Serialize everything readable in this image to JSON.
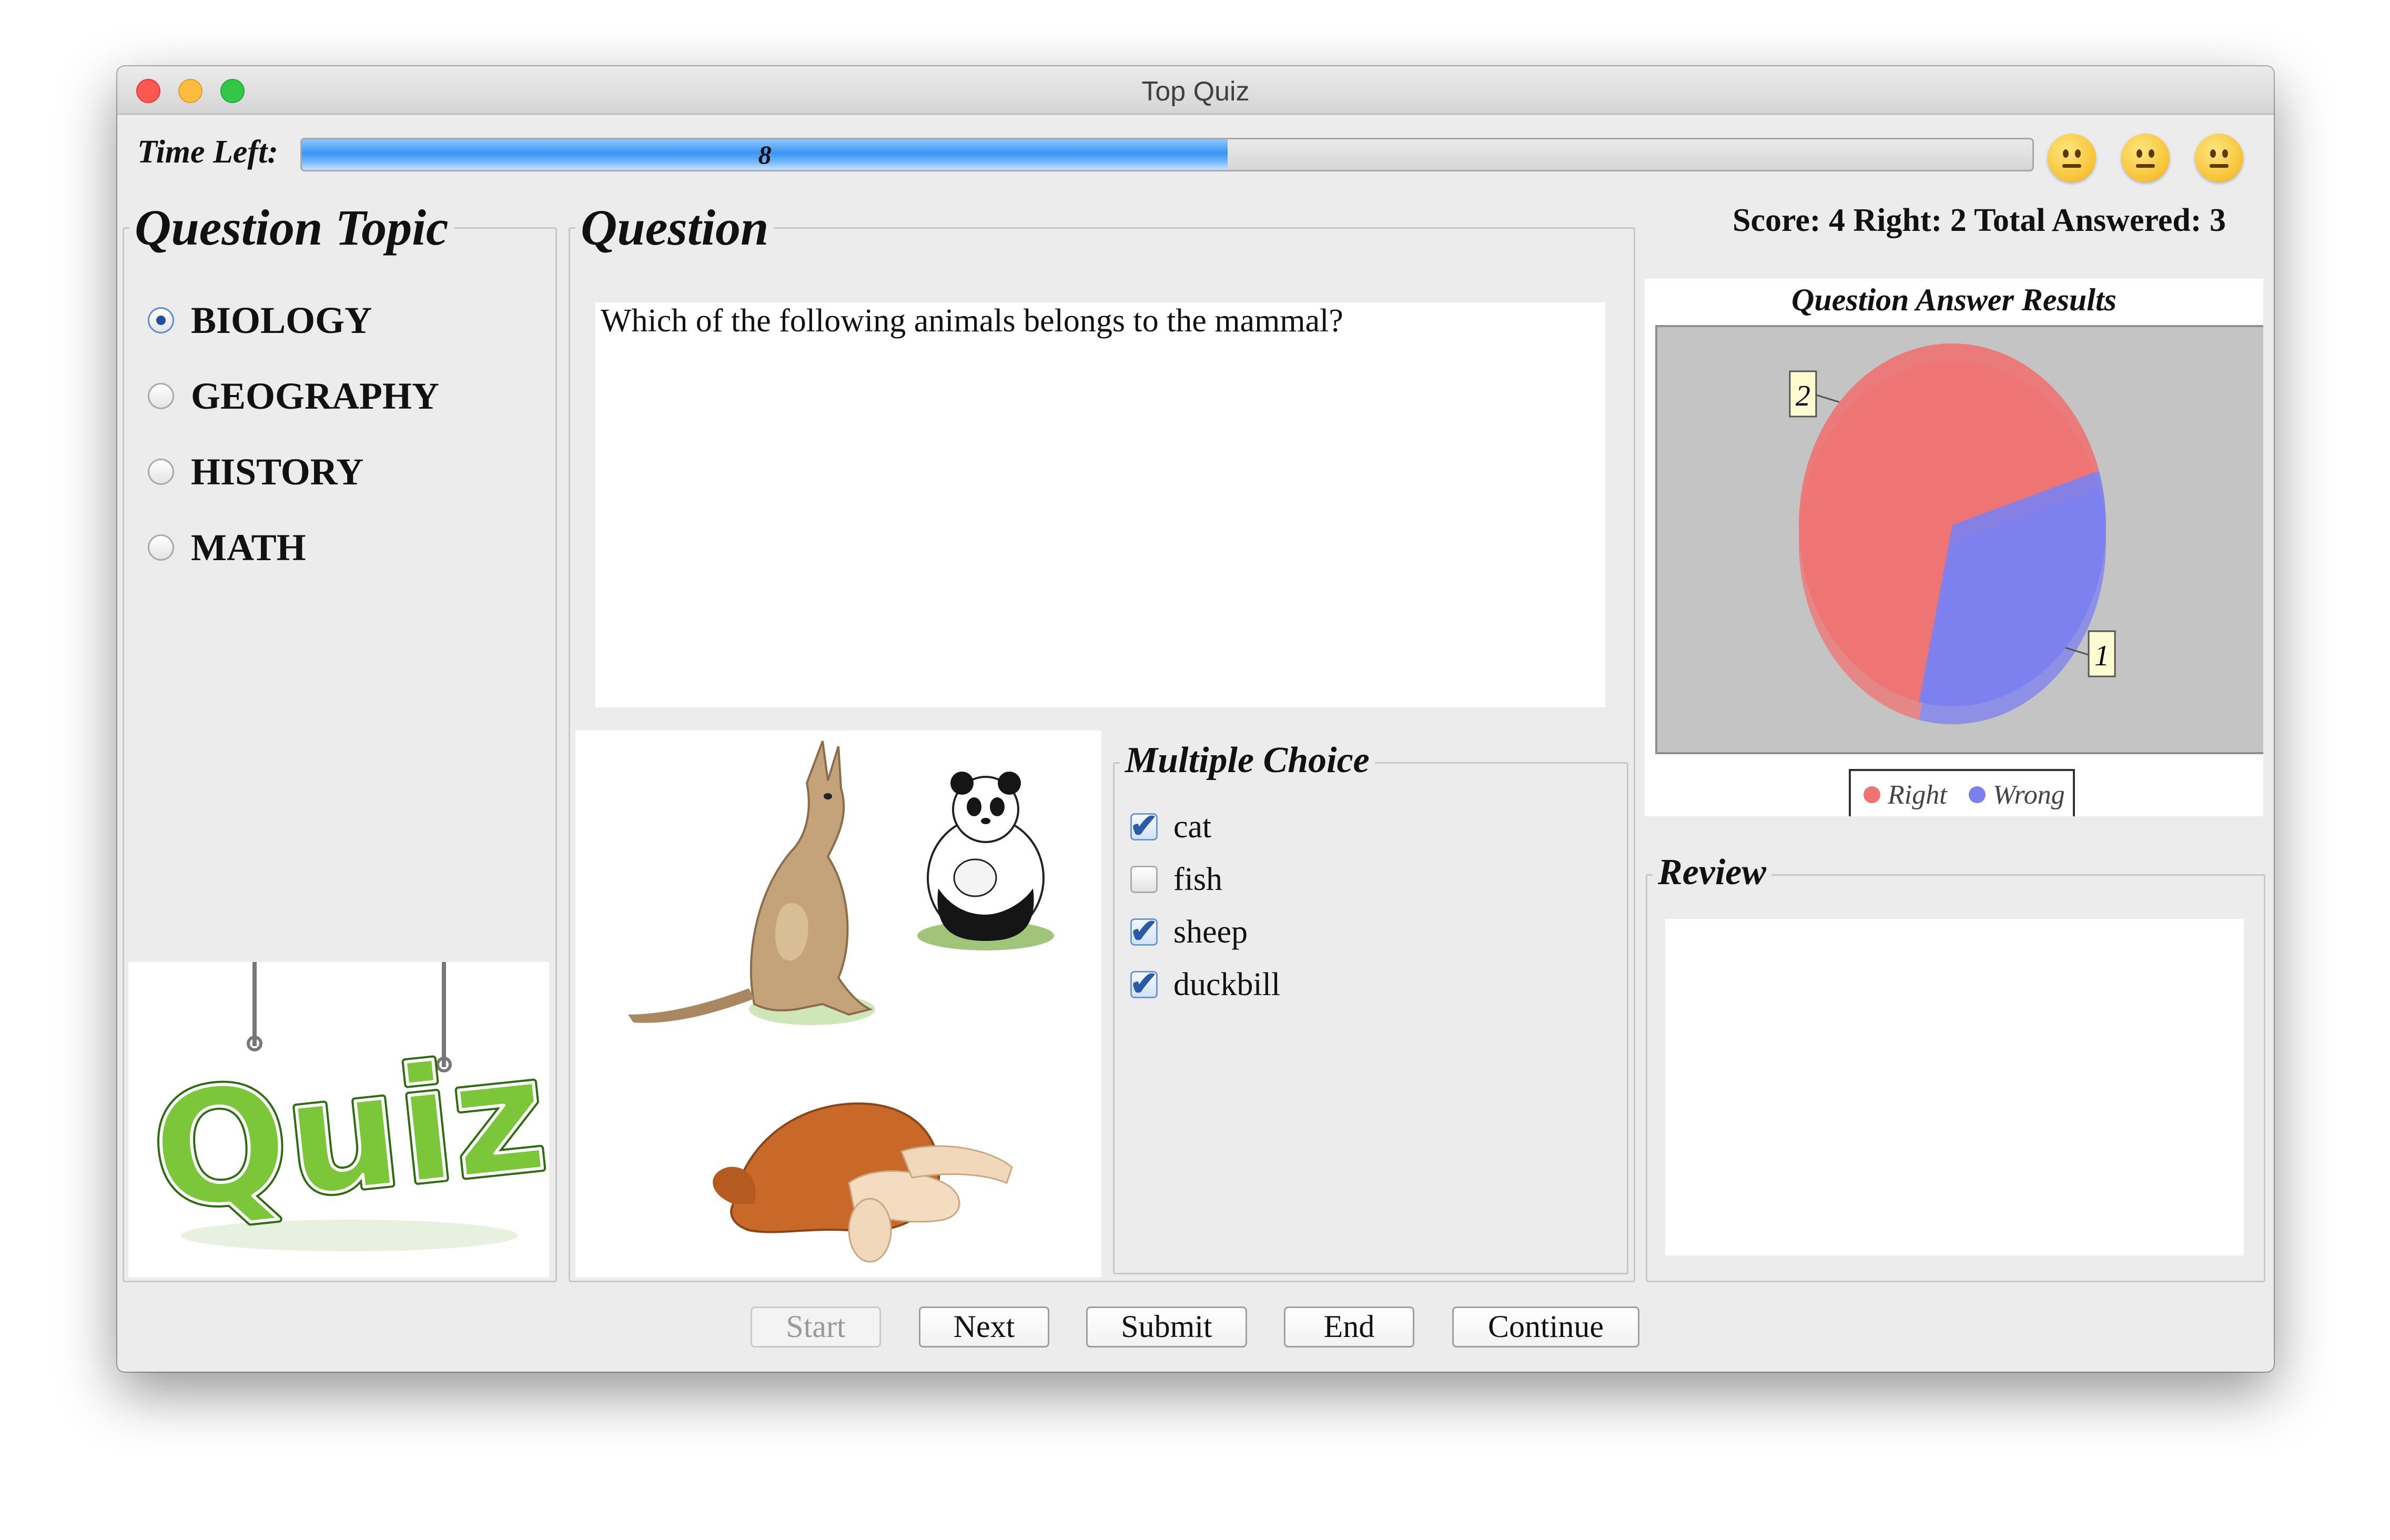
{
  "window": {
    "title": "Top Quiz"
  },
  "timer": {
    "label": "Time Left:",
    "value": "8",
    "fraction": 0.535
  },
  "faces": [
    "neutral-face-icon",
    "neutral-face-icon",
    "neutral-face-icon"
  ],
  "topics": {
    "title": "Question Topic",
    "items": [
      {
        "label": "BIOLOGY",
        "selected": true
      },
      {
        "label": "GEOGRAPHY",
        "selected": false
      },
      {
        "label": "HISTORY",
        "selected": false
      },
      {
        "label": "MATH",
        "selected": false
      }
    ],
    "logo_text": "Quiz"
  },
  "question": {
    "title": "Question",
    "text": "Which of the following animals belongs to the mammal?",
    "image": "animal-images"
  },
  "choices": {
    "title": "Multiple Choice",
    "items": [
      {
        "label": "cat",
        "checked": true
      },
      {
        "label": "fish",
        "checked": false
      },
      {
        "label": "sheep",
        "checked": true
      },
      {
        "label": "duckbill",
        "checked": true
      }
    ]
  },
  "score": {
    "text": "Score: 4  Right: 2  Total Answered: 3"
  },
  "chart_data": {
    "type": "pie",
    "title": "Question Answer Results",
    "slices": [
      {
        "name": "Right",
        "value": 2,
        "color": "#f07373"
      },
      {
        "name": "Wrong",
        "value": 1,
        "color": "#7b7ff0"
      }
    ],
    "legend": "bottom"
  },
  "review": {
    "title": "Review",
    "text": ""
  },
  "buttons": {
    "start": "Start",
    "next": "Next",
    "submit": "Submit",
    "end": "End",
    "continue": "Continue"
  }
}
